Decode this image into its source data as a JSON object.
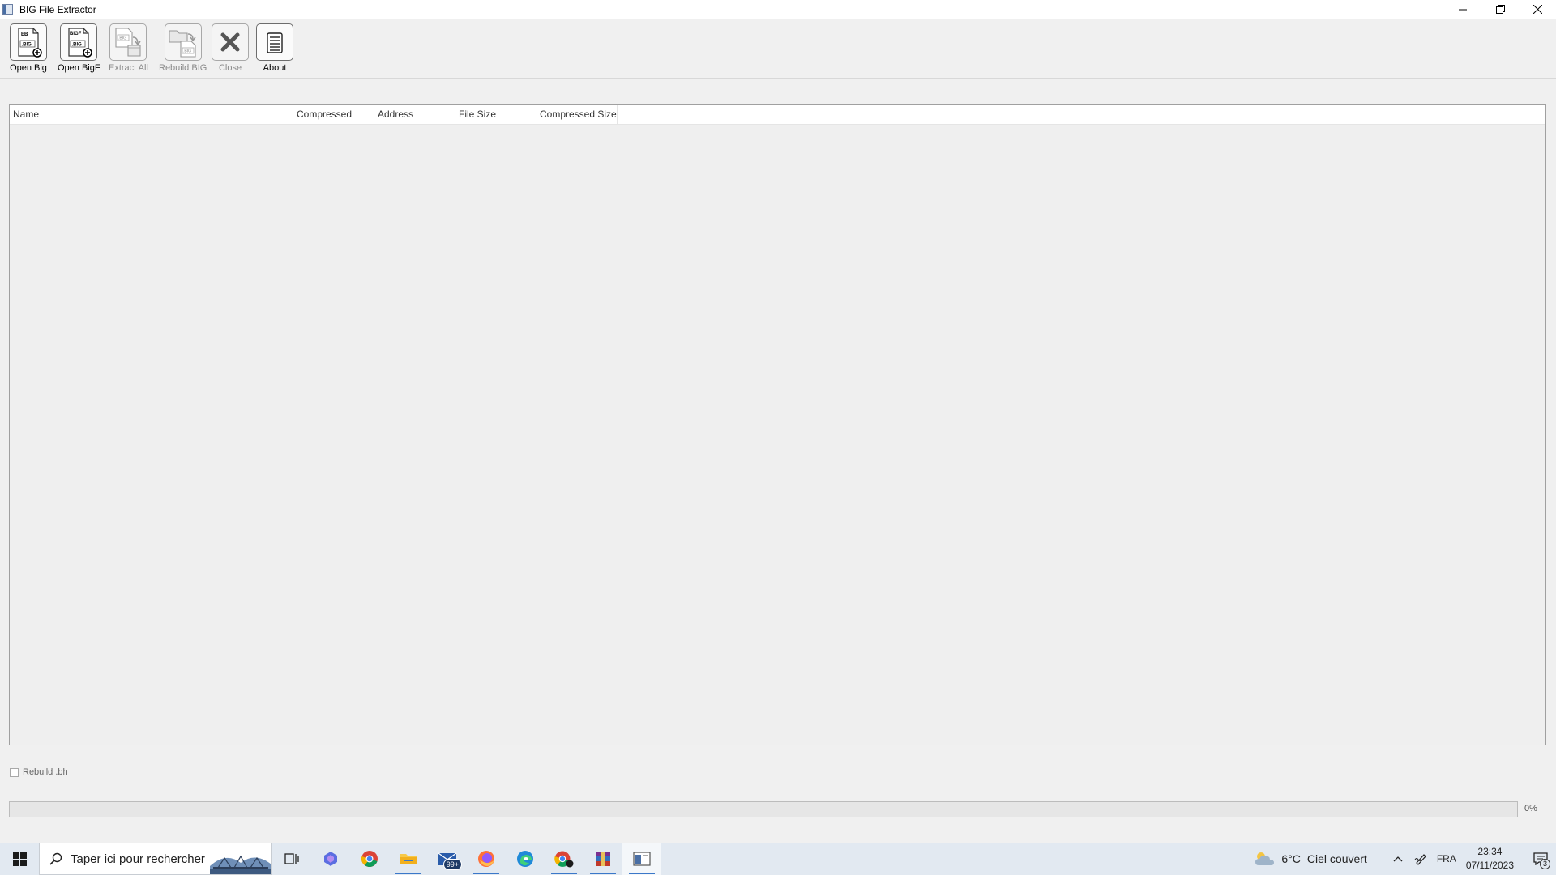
{
  "window": {
    "title": "BIG File Extractor",
    "controls": [
      "minimize",
      "restore",
      "close"
    ]
  },
  "toolbar": {
    "buttons": [
      {
        "label": "Open Big",
        "icon": "open-big-icon",
        "icon_text": [
          "EB",
          ".BIG"
        ],
        "enabled": true
      },
      {
        "label": "Open BigF",
        "icon": "open-bigf-icon",
        "icon_text": [
          "BIGF",
          ".BIG"
        ],
        "enabled": true
      },
      {
        "label": "Extract All",
        "icon": "extract-all-icon",
        "icon_text": [
          ".BIG"
        ],
        "enabled": false
      },
      {
        "label": "Rebuild BIG",
        "icon": "rebuild-big-icon",
        "icon_text": [
          ".BIG"
        ],
        "enabled": false
      },
      {
        "label": "Close",
        "icon": "close-file-icon",
        "enabled": false
      },
      {
        "label": "About",
        "icon": "about-icon",
        "enabled": true
      }
    ]
  },
  "file_list": {
    "columns": [
      "Name",
      "Compressed",
      "Address",
      "File Size",
      "Compressed Size"
    ],
    "rows": []
  },
  "options": {
    "rebuild_bh_label": "Rebuild .bh",
    "rebuild_bh_checked": false
  },
  "progress": {
    "value": 0,
    "text": "0%"
  },
  "taskbar": {
    "search_placeholder": "Taper ici pour rechercher",
    "mail_badge": "99+",
    "weather": {
      "temp": "6°C",
      "condition": "Ciel couvert"
    },
    "language": "FRA",
    "time": "23:34",
    "date": "07/11/2023",
    "notification_count": "3",
    "colors": {
      "accent": "#3b78c9",
      "background": "#e2e9f1"
    }
  }
}
